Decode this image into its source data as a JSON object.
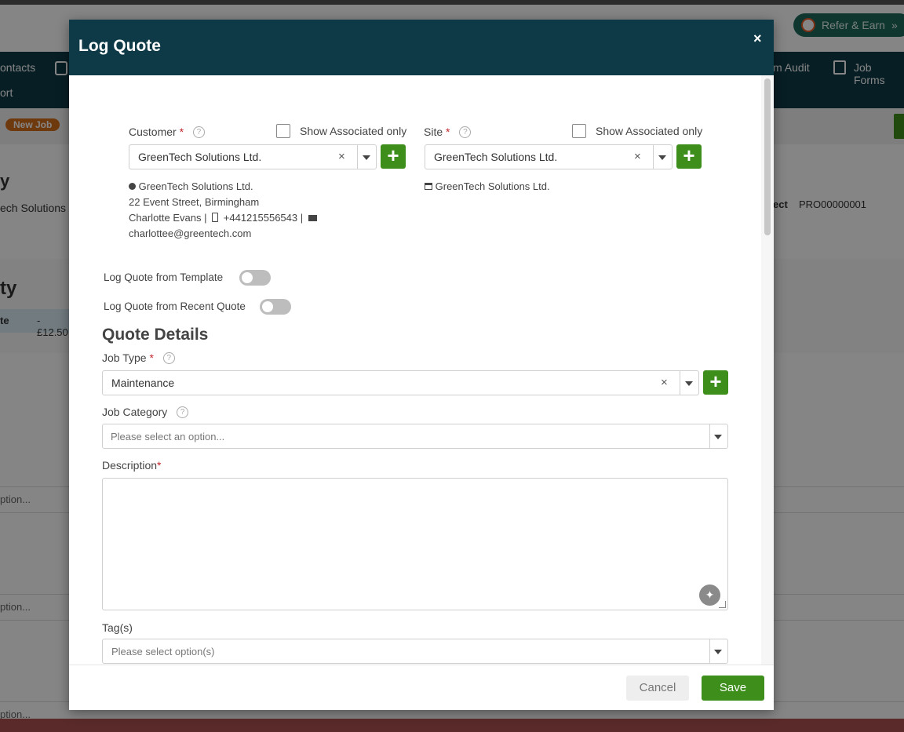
{
  "background": {
    "refer_label": "Refer & Earn",
    "refer_chevron": "»",
    "nav_items": [
      "ontacts",
      "m Audit",
      "Job Forms",
      "ort"
    ],
    "new_job_badge": "New Job",
    "page_letter_1": "y",
    "company_partial": "ech Solutions L",
    "project_label": "ect",
    "project_code": "PRO00000001",
    "section_letters": "ty",
    "row_label": "te",
    "row_amount": "-£12.50",
    "option_partial": "ption..."
  },
  "modal": {
    "title": "Log Quote",
    "close_glyph": "×",
    "customer": {
      "label": "Customer",
      "required_mark": "*",
      "help_glyph": "?",
      "show_associated_label": "Show Associated only",
      "value": "GreenTech Solutions Ltd.",
      "clear_glyph": "×",
      "add_glyph": "+",
      "details": {
        "name": "GreenTech Solutions Ltd.",
        "address": "22 Event Street, Birmingham",
        "contact": "Charlotte Evans",
        "phone": "+441215556543",
        "email": "charlottee@greentech.com",
        "separator": "|"
      }
    },
    "site": {
      "label": "Site",
      "required_mark": "*",
      "help_glyph": "?",
      "show_associated_label": "Show Associated only",
      "value": "GreenTech Solutions Ltd.",
      "clear_glyph": "×",
      "add_glyph": "+",
      "details_name": "GreenTech Solutions Ltd."
    },
    "toggles": {
      "template_label": "Log Quote from Template",
      "recent_label": "Log Quote from Recent Quote"
    },
    "quote_details": {
      "heading": "Quote Details",
      "job_type_label": "Job Type",
      "job_type_required": "*",
      "job_type_value": "Maintenance",
      "job_category_label": "Job Category",
      "job_category_placeholder": "Please select an option...",
      "description_label": "Description",
      "description_required": "*",
      "tags_label": "Tag(s)",
      "tags_placeholder": "Please select option(s)"
    },
    "footer": {
      "cancel_label": "Cancel",
      "save_label": "Save"
    }
  }
}
